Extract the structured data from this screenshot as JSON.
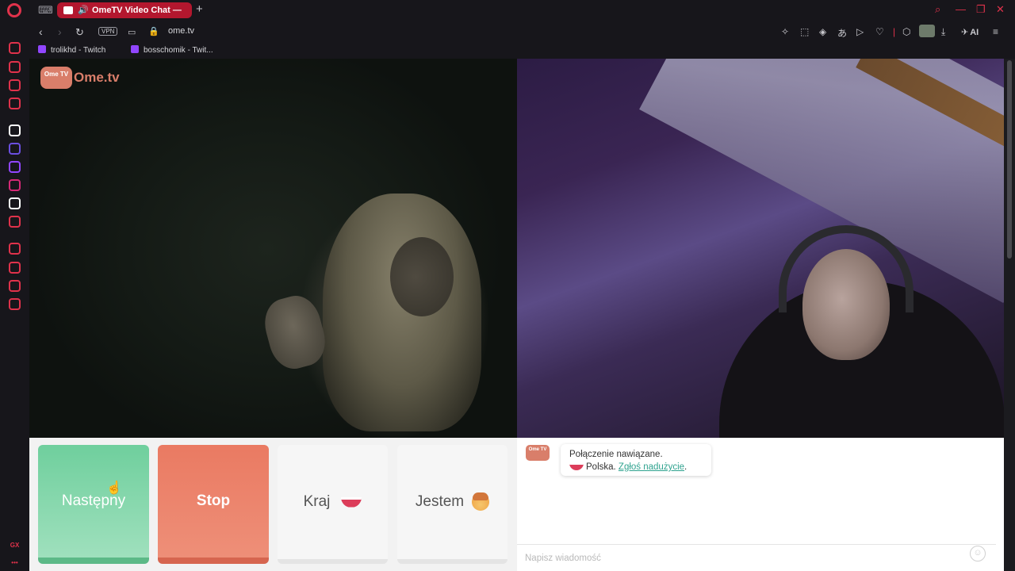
{
  "browser": {
    "tab_title": "OmeTV Video Chat — ",
    "url": "ome.tv",
    "vpn_label": "VPN",
    "ai_label": "AI",
    "bookmarks": [
      {
        "label": "trolikhd - Twitch"
      },
      {
        "label": "bosschomik - Twit..."
      }
    ],
    "sidebar_items": [
      {
        "icon": "history-icon",
        "color": "#e0324b"
      },
      {
        "icon": "aria-icon",
        "color": "#e0324b"
      },
      {
        "icon": "video-icon",
        "color": "#e0324b"
      },
      {
        "icon": "messenger-icon",
        "color": "#e0324b"
      },
      {
        "icon": "chatgpt-icon",
        "color": "#ffffff"
      },
      {
        "icon": "cs-icon",
        "color": "#6b4fe0"
      },
      {
        "icon": "twitch-icon",
        "color": "#9146ff"
      },
      {
        "icon": "instagram-icon",
        "color": "#d62976"
      },
      {
        "icon": "x-icon",
        "color": "#ffffff"
      },
      {
        "icon": "ud-icon",
        "color": "#e0324b"
      },
      {
        "icon": "player-icon",
        "color": "#e0324b"
      },
      {
        "icon": "clock-icon",
        "color": "#e0324b"
      },
      {
        "icon": "extensions-icon",
        "color": "#e0324b"
      },
      {
        "icon": "settings-icon",
        "color": "#e0324b"
      }
    ],
    "sidebar_footer": "GX",
    "accent_color": "#e0324b"
  },
  "ometv": {
    "logo_tv": "Ome TV",
    "logo_text": "Ome.tv",
    "buttons": {
      "next": "Następny",
      "stop": "Stop",
      "country": "Kraj",
      "gender": "Jestem"
    },
    "chat": {
      "status_title": "Połączenie nawiązane.",
      "country": "Polska.",
      "report_link": "Zgłoś nadużycie",
      "report_suffix": ".",
      "input_placeholder": "Napisz wiadomość"
    },
    "colors": {
      "next": "#6fcf9d",
      "stop": "#ea7a62",
      "link": "#2fa38f"
    }
  }
}
